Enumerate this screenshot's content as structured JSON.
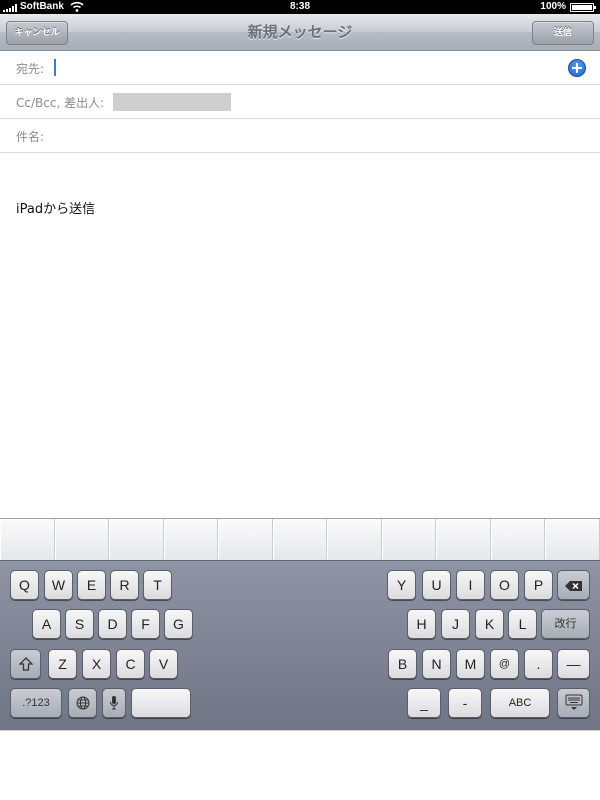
{
  "status_bar": {
    "carrier": "SoftBank",
    "time": "8:38",
    "battery_percent": "100%",
    "battery_level": 1.0
  },
  "nav": {
    "cancel_label": "キャンセル",
    "title": "新規メッセージ",
    "send_label": "送信"
  },
  "fields": {
    "to_label": "宛先:",
    "cc_from_label": "Cc/Bcc, 差出人:",
    "subject_label": "件名:"
  },
  "body": {
    "signature": "iPadから送信"
  },
  "keyboard": {
    "row1_left": [
      "Q",
      "W",
      "E",
      "R",
      "T"
    ],
    "row1_right": [
      "Y",
      "U",
      "I",
      "O",
      "P"
    ],
    "row2_left": [
      "A",
      "S",
      "D",
      "F",
      "G"
    ],
    "row2_right": [
      "H",
      "J",
      "K",
      "L"
    ],
    "return_label": "改行",
    "row3_left": [
      "Z",
      "X",
      "C",
      "V"
    ],
    "row3_right": [
      "B",
      "N",
      "M",
      "@",
      "."
    ],
    "dash_label": "—",
    "numbers_label": ".?123",
    "underscore_label": "_",
    "hyphen_label": "-",
    "abc_label": "ABC",
    "icons": {
      "delete": "backspace-icon",
      "shift": "shift-icon",
      "globe": "globe-icon",
      "mic": "microphone-icon",
      "dismiss": "keyboard-dismiss-icon"
    }
  },
  "colors": {
    "accent": "#3d78d9",
    "nav_title": "#6b7079"
  }
}
